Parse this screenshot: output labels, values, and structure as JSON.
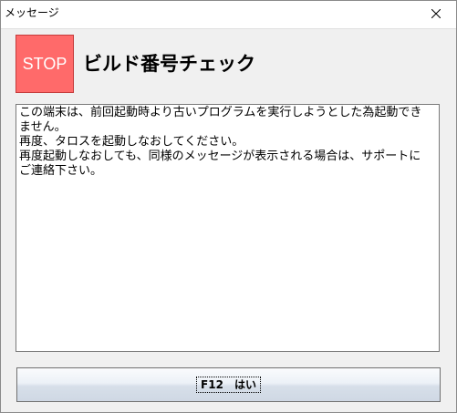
{
  "window": {
    "title": "メッセージ"
  },
  "header": {
    "stop_label": "STOP",
    "title": "ビルド番号チェック"
  },
  "message": {
    "lines": [
      "この端末は、前回起動時より古いプログラムを実行しようとした為起動でき",
      "ません。",
      "再度、タロスを起動しなおしてください。",
      "再度起動しなおしても、同様のメッセージが表示される場合は、サポートに",
      "ご連絡下さい。"
    ]
  },
  "buttons": {
    "ok_label": "F12　はい"
  },
  "icons": {
    "close": "close-icon",
    "stop": "stop-sign-icon"
  },
  "colors": {
    "stop_sign": "#ff6a6a",
    "window_bg": "#f0f0f0"
  }
}
